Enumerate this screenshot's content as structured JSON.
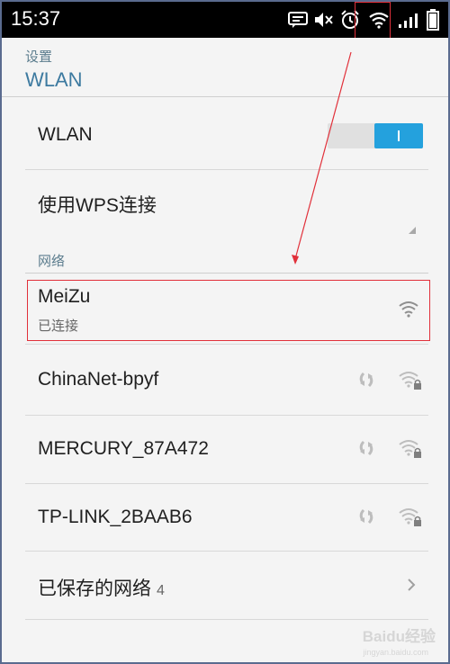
{
  "status_bar": {
    "time": "15:37",
    "icons": [
      "message-icon",
      "mute-icon",
      "alarm-icon",
      "wifi-icon",
      "signal-icon",
      "battery-icon"
    ]
  },
  "header": {
    "subtitle": "设置",
    "title": "WLAN"
  },
  "wlan_toggle": {
    "label": "WLAN",
    "on": true,
    "accent": "#24a1dd"
  },
  "wps": {
    "label": "使用WPS连接"
  },
  "networks_section": {
    "label": "网络",
    "items": [
      {
        "ssid": "MeiZu",
        "status": "已连接"
      },
      {
        "ssid": "ChinaNet-bpyf"
      },
      {
        "ssid": "MERCURY_87A472"
      },
      {
        "ssid": "TP-LINK_2BAAB6"
      }
    ]
  },
  "saved_networks": {
    "label": "已保存的网络",
    "count": "4"
  },
  "watermark": {
    "text": "Baidu经验",
    "url": "jingyan.baidu.com"
  },
  "colors": {
    "annotation": "#e1303a",
    "section_text": "#5c7d8e",
    "title_text": "#3d7aa0"
  }
}
